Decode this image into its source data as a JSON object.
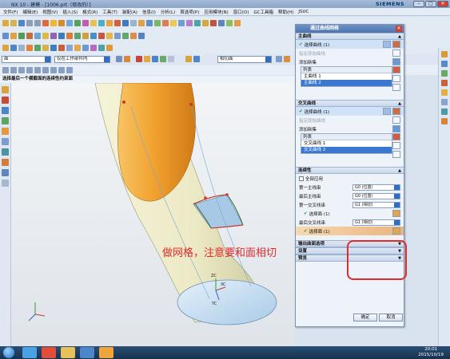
{
  "window": {
    "title": "NX 10 - 建模 - [1006.prt（修改的）]",
    "brand": "SIEMENS",
    "min": "–",
    "max": "□",
    "close": "✕"
  },
  "menu": [
    "文件(F)",
    "编辑(E)",
    "视图(V)",
    "插入(S)",
    "格式(R)",
    "工具(T)",
    "装配(A)",
    "信息(I)",
    "分析(L)",
    "首选项(P)",
    "应用模块(N)",
    "窗口(O)",
    "GC工具箱",
    "帮助(H)",
    "JSUC"
  ],
  "selection_bar": {
    "filter": "面",
    "scope": "仅在工作部件内",
    "snap": "相切面"
  },
  "hint": "选择最后一个横截面的连续性约束面",
  "annotation": "做网格，注意要和面相切",
  "triad": {
    "zc": "ZC",
    "yc": "YC",
    "xc": "XC"
  },
  "dialog": {
    "title": "通过曲线网格",
    "primary_section": "主曲线",
    "primary_select": "选择曲线 (1)",
    "specify_origin": "指定原始曲线",
    "add_new_set": "添加新集",
    "list_header": "列表",
    "primary_items": [
      "主曲线 1",
      "主曲线 2"
    ],
    "cross_section": "交叉曲线",
    "cross_select": "选择曲线 (1)",
    "cross_items": [
      "交叉曲线 1",
      "交叉曲线 2"
    ],
    "continuity_section": "连续性",
    "apply_all": "全部应用",
    "first_primary_label": "第一主线串",
    "first_primary_value": "G0 (位置)",
    "last_primary_label": "最后主线串",
    "last_primary_value": "G0 (位置)",
    "first_cross_label": "第一交叉线串",
    "first_cross_value": "G1 (相切)",
    "select_face_1": "选择面 (1)",
    "last_cross_label": "最后交叉线串",
    "last_cross_value": "G1 (相切)",
    "select_face_2": "选择面 (1)",
    "output_section": "输出曲面选项",
    "settings_section": "设置",
    "preview_section": "预览",
    "ok": "确定",
    "cancel": "取消"
  },
  "taskbar": {
    "time": "20:01",
    "date": "2015/10/19"
  },
  "colors": {
    "surface_orange": "#f2a330",
    "surface_cream": "#ece9c5",
    "annotation_red": "#e12a2a",
    "selection_blue": "#3a78d0"
  }
}
